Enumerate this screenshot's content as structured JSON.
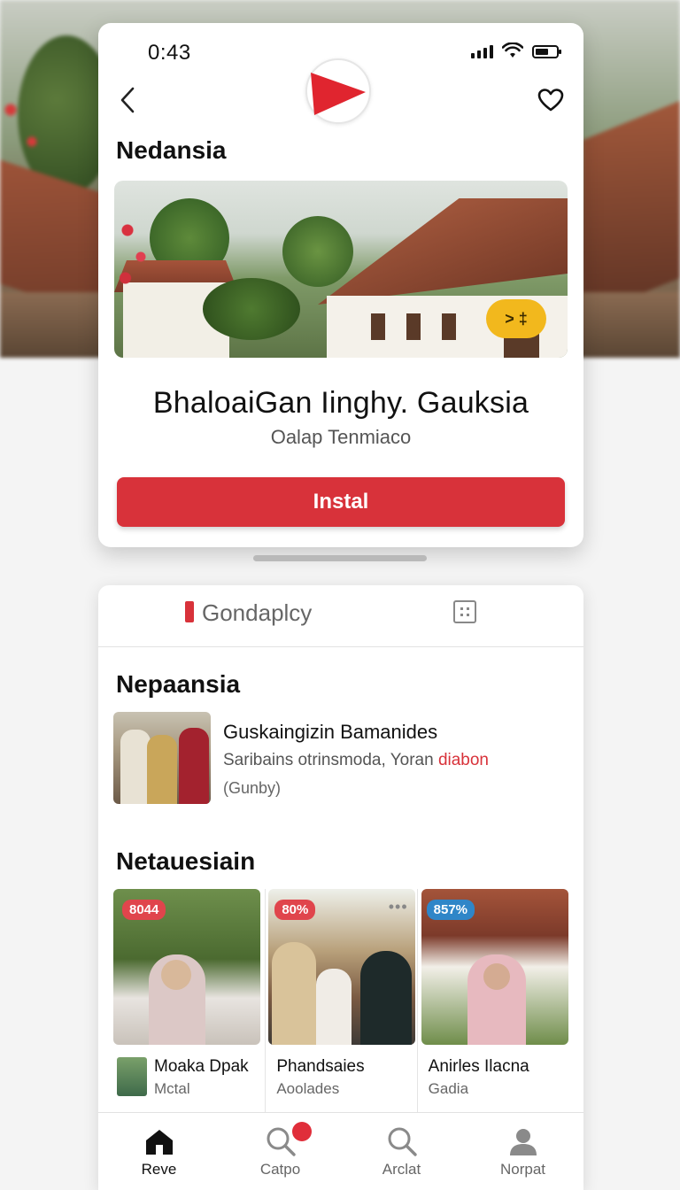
{
  "status_bar": {
    "time": "0:43"
  },
  "header": {
    "section_title": "Nedansia"
  },
  "hero": {
    "badge": "> ‡"
  },
  "app": {
    "name": "BhaloaiGan Iinghy. Gauksia",
    "subtitle": "Oalap Tenmiaco",
    "install_label": "Instal"
  },
  "tabs": {
    "active_label": "Gondaplcy"
  },
  "section1": {
    "title": "Nepaansia",
    "feature": {
      "title": "Guskaingizin Bamanides",
      "desc_main": "Saribains otrinsmoda, Yoran ",
      "desc_accent": "diabon",
      "meta": "(Gunby)"
    }
  },
  "section2": {
    "title": "Netauesiain",
    "tiles": [
      {
        "badge": "8044",
        "badge_color": "#e0454c",
        "title": "Moaka Dpak",
        "sub": "Mctal"
      },
      {
        "badge": "80%",
        "badge_color": "#e0454c",
        "more": "•••",
        "title": "Phandsaies",
        "sub": "Aoolades"
      },
      {
        "badge": "857%",
        "badge_color": "#2f86c8",
        "title": "Anirles Ilacna",
        "sub": "Gadia"
      }
    ]
  },
  "bottom_nav": [
    {
      "label": "Reve",
      "icon": "home-icon"
    },
    {
      "label": "Catpo",
      "icon": "search-icon"
    },
    {
      "label": "Arclat",
      "icon": "search-icon"
    },
    {
      "label": "Norpat",
      "icon": "profile-icon"
    }
  ],
  "colors": {
    "accent": "#d8323a",
    "badge_yellow": "#f2b81d"
  }
}
